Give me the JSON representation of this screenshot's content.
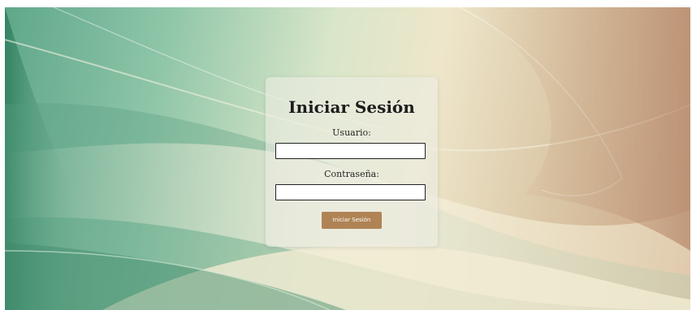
{
  "login": {
    "title": "Iniciar Sesión",
    "username_label": "Usuario:",
    "username_value": "",
    "password_label": "Contraseña:",
    "password_value": "",
    "submit_label": "Iniciar Sesión"
  },
  "colors": {
    "button_background": "#b08355",
    "button_text": "#ffffff",
    "card_background": "#ecece2"
  }
}
